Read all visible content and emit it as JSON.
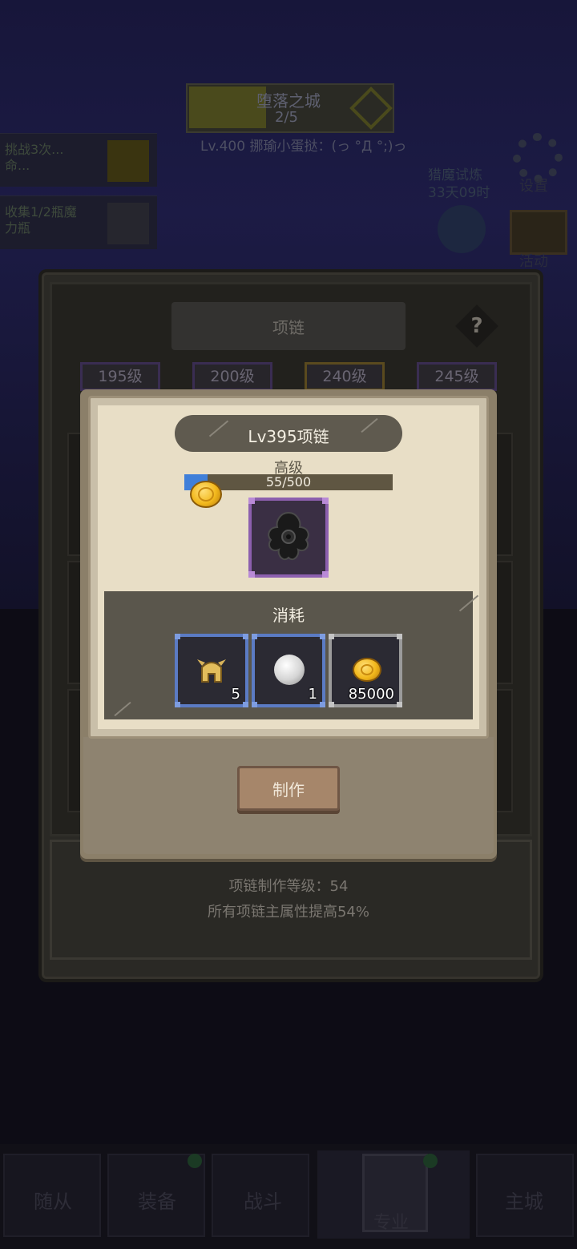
{
  "background": {
    "stage": {
      "name": "堕落之城",
      "progress": "2/5"
    },
    "boss_text": "Lv.400 挪瑜小蛋挞：(っ °Д °;)っ",
    "quests": [
      {
        "text": "挑战3次...\n命..."
      },
      {
        "text": "收集1/2瓶魔\n力瓶"
      }
    ],
    "side_buttons": {
      "settings": "设置",
      "events": "活动"
    },
    "trial_text": "猎魔试炼\n33天09时"
  },
  "main_panel": {
    "title": "项链",
    "help_label": "?",
    "level_tabs": [
      "195级",
      "200级",
      "240级",
      "245级"
    ],
    "info_level": "项链制作等级：54",
    "info_bonus": "所有项链主属性提高54%"
  },
  "popup": {
    "title": "Lv395项链",
    "grade": "高级",
    "progress": {
      "current": 55,
      "max": 500,
      "label": "55/500"
    },
    "result_item": "necklace-icon",
    "consume_title": "消耗",
    "materials": [
      {
        "icon": "helmet-icon",
        "count": "5",
        "rarity": "blue"
      },
      {
        "icon": "stone-icon",
        "count": "1",
        "rarity": "blue"
      },
      {
        "icon": "coin-icon",
        "count": "85000",
        "rarity": "gray"
      }
    ],
    "make_button": "制作"
  },
  "bottom_nav": [
    "随从",
    "装备",
    "战斗",
    "专业",
    "主城"
  ],
  "colors": {
    "popup_bg": "#e8dec6",
    "title_pill": "#5f5a4f",
    "progress_fill": "#3f7fd9",
    "rare_border": "#5b7bc4",
    "epic_border": "#8c5fae"
  }
}
